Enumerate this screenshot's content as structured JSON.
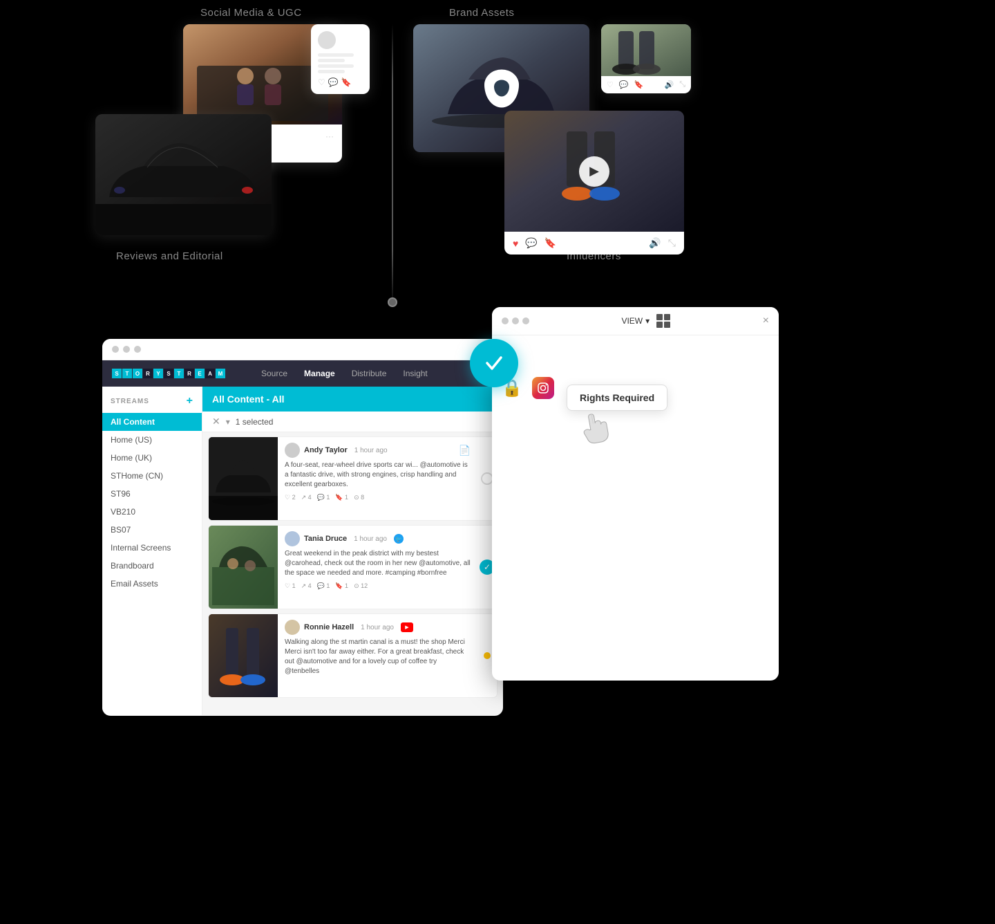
{
  "scene": {
    "background": "#000000"
  },
  "labels": {
    "social_media": "Social Media & UGC",
    "brand_assets": "Brand Assets",
    "reviews_editorial": "Reviews and Editorial",
    "influencers": "Influencers"
  },
  "app": {
    "logo_text": "STORYSTREAM",
    "nav_items": [
      "Source",
      "Manage",
      "Distribute",
      "Insight"
    ],
    "active_nav": "Manage",
    "streams_header": "STREAMS",
    "streams_add_label": "+",
    "sidebar_items": [
      {
        "label": "All Content",
        "active": true
      },
      {
        "label": "Home (US)"
      },
      {
        "label": "Home (UK)"
      },
      {
        "label": "STHome (CN)"
      },
      {
        "label": "ST96"
      },
      {
        "label": "VB210"
      },
      {
        "label": "BS07"
      },
      {
        "label": "Internal Screens"
      },
      {
        "label": "Brandboard"
      },
      {
        "label": "Email Assets"
      }
    ],
    "content_title": "All Content - All",
    "selection": "1 selected",
    "posts": [
      {
        "author": "Andy Taylor",
        "time": "1 hour ago",
        "text": "A four-seat, rear-wheel drive sports car wi... @automotive is a fantastic drive, with strong engines, crisp handling and excellent gearboxes.",
        "stats": [
          "2",
          "4",
          "1",
          "1",
          "8"
        ],
        "has_check": false,
        "has_doc": true
      },
      {
        "author": "Tania Druce",
        "time": "1 hour ago",
        "text": "Great weekend in the peak district with my bestest @carohead, check out the room in her new @automotive, all the space we needed and more. #camping #bornfree",
        "stats": [
          "1",
          "4",
          "1",
          "1",
          "12"
        ],
        "has_check": true,
        "has_doc": false
      },
      {
        "author": "Ronnie Hazell",
        "time": "1 hour ago",
        "text": "Walking along the st martin canal is a must! the shop Merci Merci isn't too far away either. For a great breakfast, check out @automotive and for a lovely cup of coffee try @tenbelles",
        "stats": [],
        "has_check": false,
        "has_doc": false,
        "has_amber": true
      }
    ]
  },
  "panel": {
    "view_label": "VIEW",
    "close_icon": "×",
    "rights_required": "Rights Required"
  },
  "icons": {
    "lock": "🔒",
    "instagram": "📷",
    "check": "✓",
    "play": "▶",
    "close": "×",
    "dropdown": "▾",
    "x": "✕",
    "heart": "♡",
    "chat": "💬",
    "bookmark": "🔖",
    "volume": "🔊",
    "expand": "⤢",
    "share": "↗",
    "like": "👍",
    "twitter": "🐦",
    "youtube": "▶",
    "grid": "⊞",
    "star": "★"
  }
}
